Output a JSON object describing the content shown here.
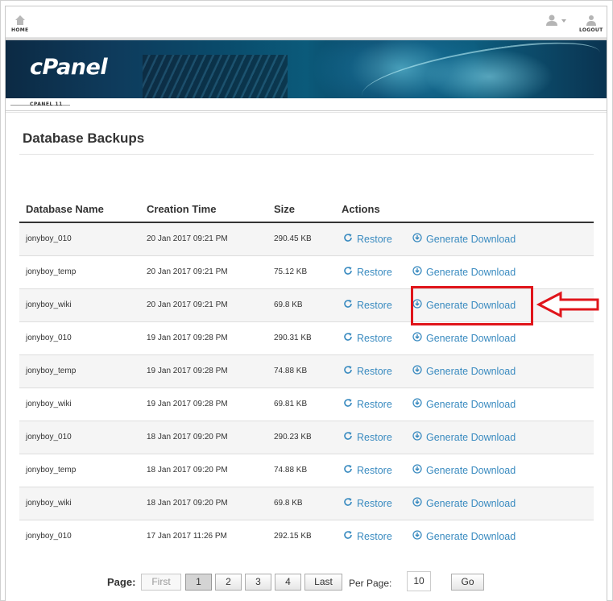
{
  "nav": {
    "home_label": "HOME",
    "logout_label": "LOGOUT"
  },
  "banner": {
    "logo_text": "cPanel",
    "version_label": "CPANEL 11"
  },
  "page": {
    "title": "Database Backups"
  },
  "table": {
    "headers": [
      "Database Name",
      "Creation Time",
      "Size",
      "Actions"
    ],
    "restore_label": "Restore",
    "download_label": "Generate Download",
    "rows": [
      {
        "name": "jonyboy_010",
        "time": "20 Jan 2017 09:21 PM",
        "size": "290.45 KB"
      },
      {
        "name": "jonyboy_temp",
        "time": "20 Jan 2017 09:21 PM",
        "size": "75.12 KB"
      },
      {
        "name": "jonyboy_wiki",
        "time": "20 Jan 2017 09:21 PM",
        "size": "69.8 KB"
      },
      {
        "name": "jonyboy_010",
        "time": "19 Jan 2017 09:28 PM",
        "size": "290.31 KB"
      },
      {
        "name": "jonyboy_temp",
        "time": "19 Jan 2017 09:28 PM",
        "size": "74.88 KB"
      },
      {
        "name": "jonyboy_wiki",
        "time": "19 Jan 2017 09:28 PM",
        "size": "69.81 KB"
      },
      {
        "name": "jonyboy_010",
        "time": "18 Jan 2017 09:20 PM",
        "size": "290.23 KB"
      },
      {
        "name": "jonyboy_temp",
        "time": "18 Jan 2017 09:20 PM",
        "size": "74.88 KB"
      },
      {
        "name": "jonyboy_wiki",
        "time": "18 Jan 2017 09:20 PM",
        "size": "69.8 KB"
      },
      {
        "name": "jonyboy_010",
        "time": "17 Jan 2017 11:26 PM",
        "size": "292.15 KB"
      }
    ]
  },
  "pagination": {
    "page_label": "Page:",
    "first_label": "First",
    "pages": [
      "1",
      "2",
      "3",
      "4"
    ],
    "current_page": "1",
    "last_label": "Last",
    "per_page_label": "Per Page:",
    "per_page_value": "10",
    "go_label": "Go"
  },
  "colors": {
    "link": "#3a8bc0",
    "highlight": "#e0151b"
  },
  "icons": {
    "home": "home-icon",
    "user": "user-icon",
    "logout": "logout-icon",
    "restore": "refresh-icon",
    "download": "download-circle-icon",
    "annotation": "left-arrow-icon"
  }
}
